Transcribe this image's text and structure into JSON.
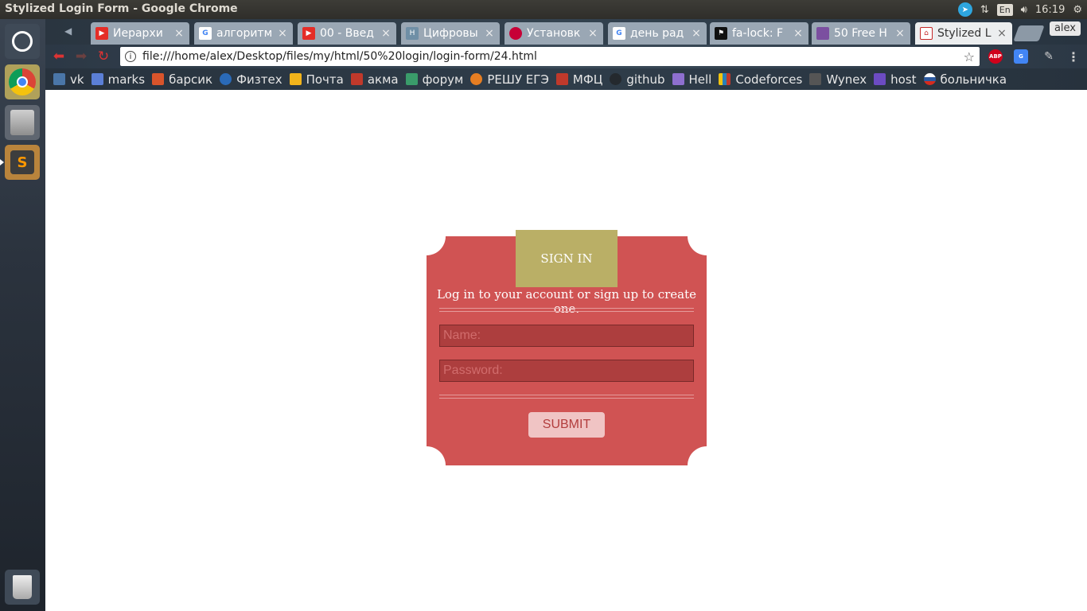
{
  "os": {
    "window_title": "Stylized Login Form - Google Chrome",
    "keyboard_layout": "En",
    "clock": "16:19"
  },
  "browser": {
    "tabs": [
      {
        "title": "Иерархи",
        "favicon": "youtube-icon",
        "color": "#e52d27"
      },
      {
        "title": "алгоритм",
        "favicon": "google-icon",
        "color": "#4285f4"
      },
      {
        "title": "00 - Введ",
        "favicon": "youtube-icon",
        "color": "#e52d27"
      },
      {
        "title": "Цифровы",
        "favicon": "habr-icon",
        "color": "#6f8fa6"
      },
      {
        "title": "Установк",
        "favicon": "debian-icon",
        "color": "#c70036"
      },
      {
        "title": "день рад",
        "favicon": "google-icon",
        "color": "#4285f4"
      },
      {
        "title": "fa-lock: F",
        "favicon": "flag-icon",
        "color": "#111111"
      },
      {
        "title": "50 Free H",
        "favicon": "colorlib-icon",
        "color": "#7b4fa0"
      },
      {
        "title": "Stylized L",
        "favicon": "html-icon",
        "color": "#c62828",
        "active": true
      }
    ],
    "profile_name": "alex",
    "url": "file:///home/alex/Desktop/files/my/html/50%20login/login-form/24.html",
    "extensions": {
      "adblock": "ABP"
    },
    "bookmarks": [
      {
        "label": "vk",
        "color": "#4a76a8"
      },
      {
        "label": "marks",
        "color": "#5b7fd6"
      },
      {
        "label": "барсик",
        "color": "#d9542b"
      },
      {
        "label": "Физтех",
        "color": "#2a6ab8"
      },
      {
        "label": "Почта",
        "color": "#f2b41b"
      },
      {
        "label": "акма",
        "color": "#c0392b"
      },
      {
        "label": "форум",
        "color": "#3a9c6a"
      },
      {
        "label": "РЕШУ ЕГЭ",
        "color": "#e67e22"
      },
      {
        "label": "МФЦ",
        "color": "#c0392b"
      },
      {
        "label": "github",
        "color": "#24292e"
      },
      {
        "label": "Hell",
        "color": "#8e6fcf"
      },
      {
        "label": "Codeforces",
        "color": "#f1c40f"
      },
      {
        "label": "Wynex",
        "color": "#555555"
      },
      {
        "label": "host",
        "color": "#6c4bc2"
      },
      {
        "label": "больничка",
        "color": "#2c5aa0"
      }
    ]
  },
  "login_form": {
    "heading": "SIGN IN",
    "subtitle": "Log in to your account or sign up to create one.",
    "name_placeholder": "Name:",
    "password_placeholder": "Password:",
    "submit_label": "SUBMIT"
  }
}
